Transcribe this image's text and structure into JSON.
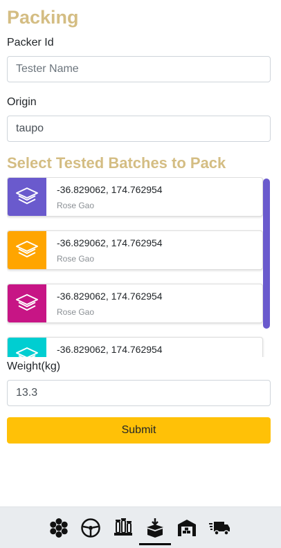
{
  "colors": {
    "accent": "#d4bd83",
    "submit": "#ffc107",
    "scrollbar": "#6a5acd"
  },
  "page": {
    "title": "Packing"
  },
  "packer": {
    "label": "Packer Id",
    "placeholder": "Tester Name",
    "value": ""
  },
  "origin": {
    "label": "Origin",
    "value": "taupo"
  },
  "batches": {
    "title": "Select Tested Batches to Pack",
    "items": [
      {
        "coords": "-36.829062, 174.762954",
        "tester": "Rose Gao",
        "color": "#6a5acd",
        "icon": "layers-icon"
      },
      {
        "coords": "-36.829062, 174.762954",
        "tester": "Rose Gao",
        "color": "#ffa500",
        "icon": "layers-icon"
      },
      {
        "coords": "-36.829062, 174.762954",
        "tester": "Rose Gao",
        "color": "#c71585",
        "icon": "layers-icon"
      },
      {
        "coords": "-36.829062, 174.762954",
        "tester": "",
        "color": "#00ced1",
        "icon": "layers-icon"
      }
    ]
  },
  "weight": {
    "label": "Weight(kg)",
    "value": "13.3"
  },
  "submit": {
    "label": "Submit"
  },
  "nav": {
    "active_index": 3,
    "items": [
      {
        "icon": "hexagons-icon"
      },
      {
        "icon": "steering-wheel-icon"
      },
      {
        "icon": "test-tubes-icon"
      },
      {
        "icon": "packing-box-icon"
      },
      {
        "icon": "warehouse-icon"
      },
      {
        "icon": "delivery-truck-icon"
      }
    ]
  }
}
